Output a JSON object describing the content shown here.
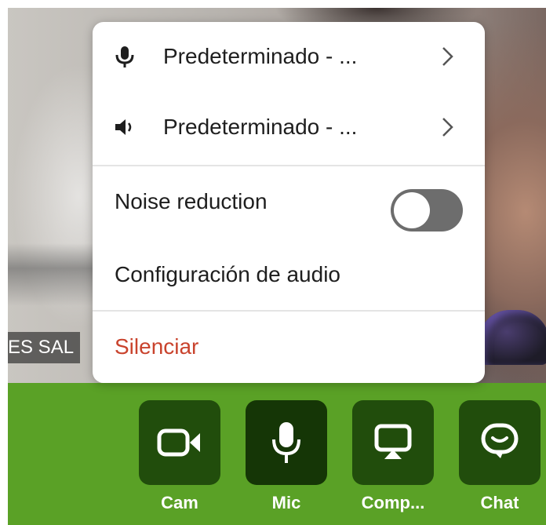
{
  "video": {
    "participant_name": "ES SAL"
  },
  "menu": {
    "microphone": {
      "label": "Predeterminado - ...",
      "icon": "microphone-icon"
    },
    "speaker": {
      "label": "Predeterminado - ...",
      "icon": "speaker-icon"
    },
    "noise_reduction": {
      "label": "Noise reduction",
      "enabled": false
    },
    "audio_settings_label": "Configuración de audio",
    "mute_label": "Silenciar",
    "mute_color": "#c9432d"
  },
  "toolbar": {
    "background": "#5aa126",
    "buttons": [
      {
        "label": "Cam",
        "icon": "camera-icon"
      },
      {
        "label": "Mic",
        "icon": "microphone-icon",
        "active": true
      },
      {
        "label": "Comp...",
        "icon": "screen-share-icon"
      },
      {
        "label": "Chat",
        "icon": "chat-icon"
      }
    ]
  }
}
